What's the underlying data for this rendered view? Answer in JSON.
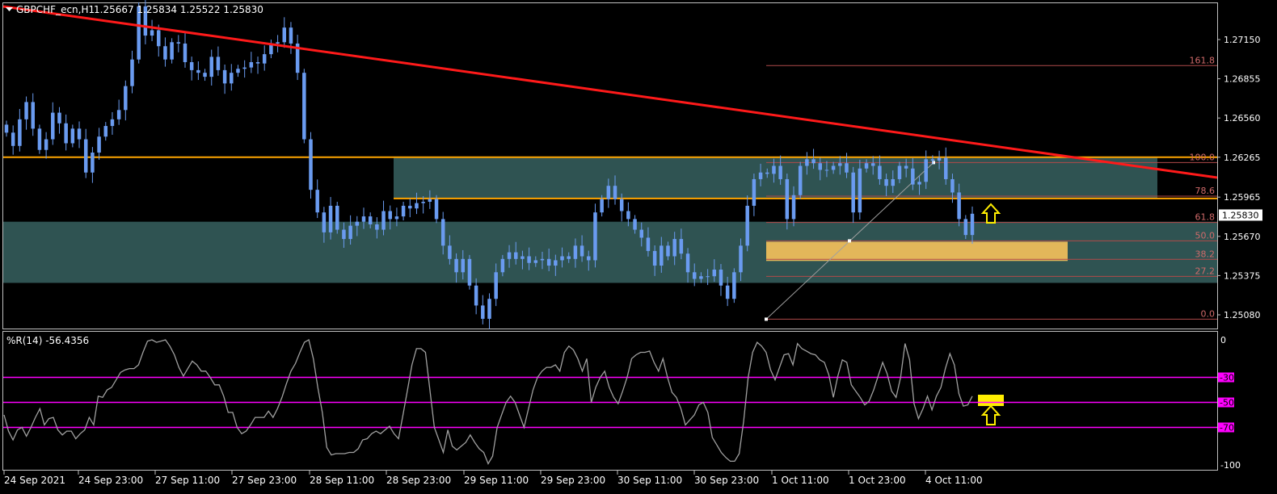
{
  "header": {
    "symbol": "GBPCHF_ecn,H1",
    "ohlc": "1.25667 1.25834 1.25522 1.25830"
  },
  "indicator": {
    "label": "%R(14) -56.4356"
  },
  "colors": {
    "background": "#000000",
    "frame": "#c0c0c0",
    "candle_up": "#6a9bf0",
    "candle_down": "#6a9bf0",
    "trendline": "#ff1a1a",
    "resistance": "#ffa500",
    "zone": "#2f5352",
    "fib_zone": "#e3b75a",
    "fib_line": "#b04a4a",
    "fib_text": "#d06a6a",
    "arrow": "#ffee00",
    "wpr_line": "#a0a0a0",
    "wpr_levels": "#ff00ff"
  },
  "chart_data": [
    {
      "type": "candlestick",
      "title": "GBPCHF_ecn,H1",
      "y_ticks": [
        "1.27150",
        "1.26855",
        "1.26560",
        "1.26265",
        "1.25965",
        "1.25670",
        "1.25375",
        "1.25080"
      ],
      "current_price": "1.25830",
      "ylim": [
        1.2502,
        1.2744
      ],
      "x_tick_labels": [
        "24 Sep 2021",
        "24 Sep 23:00",
        "27 Sep 11:00",
        "27 Sep 23:00",
        "28 Sep 11:00",
        "28 Sep 23:00",
        "29 Sep 11:00",
        "29 Sep 23:00",
        "30 Sep 11:00",
        "30 Sep 23:00",
        "1 Oct 11:00",
        "1 Oct 23:00",
        "4 Oct 11:00"
      ],
      "close": [
        1.2645,
        1.2635,
        1.2655,
        1.2668,
        1.2648,
        1.2632,
        1.264,
        1.266,
        1.2652,
        1.2637,
        1.2648,
        1.264,
        1.2615,
        1.263,
        1.2642,
        1.265,
        1.2655,
        1.2662,
        1.268,
        1.27,
        1.274,
        1.2718,
        1.2722,
        1.271,
        1.27,
        1.2713,
        1.2712,
        1.2698,
        1.2692,
        1.269,
        1.2687,
        1.2702,
        1.2692,
        1.2682,
        1.269,
        1.2693,
        1.2694,
        1.2698,
        1.2697,
        1.2704,
        1.2712,
        1.2713,
        1.2724,
        1.2712,
        1.269,
        1.264,
        1.2602,
        1.2585,
        1.257,
        1.259,
        1.2572,
        1.2565,
        1.2575,
        1.2578,
        1.2582,
        1.2576,
        1.2572,
        1.2586,
        1.258,
        1.2582,
        1.259,
        1.2588,
        1.2592,
        1.2593,
        1.2595,
        1.258,
        1.256,
        1.255,
        1.254,
        1.255,
        1.253,
        1.2515,
        1.2505,
        1.252,
        1.254,
        1.255,
        1.2555,
        1.255,
        1.2552,
        1.2547,
        1.2549,
        1.255,
        1.2545,
        1.2549,
        1.2552,
        1.255,
        1.256,
        1.2552,
        1.2549,
        1.2585,
        1.2595,
        1.2605,
        1.2595,
        1.2586,
        1.258,
        1.2572,
        1.2566,
        1.2556,
        1.2545,
        1.256,
        1.2552,
        1.2565,
        1.2554,
        1.254,
        1.2535,
        1.2537,
        1.2537,
        1.2542,
        1.253,
        1.252,
        1.254,
        1.256,
        1.259,
        1.261,
        1.2615,
        1.2614,
        1.262,
        1.261,
        1.258,
        1.2598,
        1.262,
        1.2625,
        1.2622,
        1.2617,
        1.2617,
        1.262,
        1.2622,
        1.2615,
        1.2585,
        1.2618,
        1.2622,
        1.262,
        1.261,
        1.2605,
        1.261,
        1.262,
        1.2618,
        1.2606,
        1.2608,
        1.2625,
        1.2624,
        1.2626,
        1.261,
        1.26,
        1.258,
        1.2568,
        1.2584
      ]
    },
    {
      "type": "line",
      "title": "%R(14)",
      "ylim": [
        -100,
        0
      ],
      "y_ticks": [
        "0",
        "-30",
        "-50",
        "-70",
        "-100"
      ],
      "levels": [
        -30,
        -50,
        -70
      ],
      "series": [
        {
          "values": [
            -60,
            -73,
            -80,
            -72,
            -70,
            -77,
            -70,
            -62,
            -55,
            -68,
            -63,
            -62,
            -72,
            -76,
            -73,
            -73,
            -79,
            -75,
            -72,
            -62,
            -68,
            -45,
            -46,
            -40,
            -38,
            -32,
            -26,
            -24,
            -23,
            -23,
            -20,
            -10,
            -1,
            0,
            -2,
            -1,
            0,
            -5,
            -12,
            -22,
            -29,
            -23,
            -17,
            -20,
            -25,
            -25,
            -30,
            -36,
            -36,
            -45,
            -58,
            -58,
            -70,
            -75,
            -73,
            -68,
            -62,
            -62,
            -62,
            -57,
            -62,
            -55,
            -46,
            -35,
            -25,
            -19,
            -10,
            -2,
            0,
            -15,
            -38,
            -58,
            -86,
            -92,
            -91,
            -91,
            -91,
            -90,
            -90,
            -87,
            -80,
            -79,
            -75,
            -73,
            -75,
            -72,
            -69,
            -75,
            -79,
            -60,
            -40,
            -20,
            -7,
            -7,
            -10,
            -40,
            -70,
            -80,
            -90,
            -72,
            -85,
            -88,
            -85,
            -82,
            -76,
            -82,
            -87,
            -90,
            -99,
            -93,
            -70,
            -60,
            -50,
            -45,
            -50,
            -60,
            -70,
            -55,
            -40,
            -30,
            -25,
            -22,
            -22,
            -20,
            -25,
            -10,
            -5,
            -8,
            -15,
            -25,
            -15,
            -50,
            -38,
            -30,
            -25,
            -38,
            -46,
            -51,
            -41,
            -30,
            -15,
            -12,
            -10,
            -10,
            -9,
            -18,
            -25,
            -15,
            -30,
            -42,
            -46,
            -55,
            -68,
            -64,
            -60,
            -52,
            -50,
            -58,
            -78,
            -84,
            -90,
            -94,
            -97,
            -97,
            -91,
            -65,
            -30,
            -10,
            -2,
            -5,
            -10,
            -24,
            -32,
            -22,
            -12,
            -11,
            -20,
            -3,
            -7,
            -9,
            -11,
            -12,
            -16,
            -18,
            -28,
            -46,
            -29,
            -16,
            -18,
            -36,
            -41,
            -46,
            -52,
            -49,
            -40,
            -29,
            -18,
            -27,
            -41,
            -46,
            -30,
            -3,
            -16,
            -51,
            -63,
            -55,
            -45,
            -56,
            -45,
            -38,
            -23,
            -11,
            -20,
            -43,
            -53,
            -52,
            -45
          ]
        }
      ]
    }
  ],
  "annotations": {
    "fib_levels": [
      {
        "label": "161.8",
        "price": 1.26954
      },
      {
        "label": "100.0",
        "price": 1.26225
      },
      {
        "label": "78.6",
        "price": 1.25972
      },
      {
        "label": "61.8",
        "price": 1.25774
      },
      {
        "label": "50.0",
        "price": 1.25636
      },
      {
        "label": "38.2",
        "price": 1.25497
      },
      {
        "label": "27.2",
        "price": 1.25369
      },
      {
        "label": "0.0",
        "price": 1.25047
      }
    ],
    "resistance_price": 1.26265,
    "resistance_price_2": 1.25955,
    "zone": {
      "top": 1.2627,
      "bottom": 1.2596
    },
    "zone2": {
      "top": 1.2578,
      "bottom": 1.2532
    },
    "fib_zone": {
      "top": 1.2563,
      "bottom": 1.25485
    }
  }
}
